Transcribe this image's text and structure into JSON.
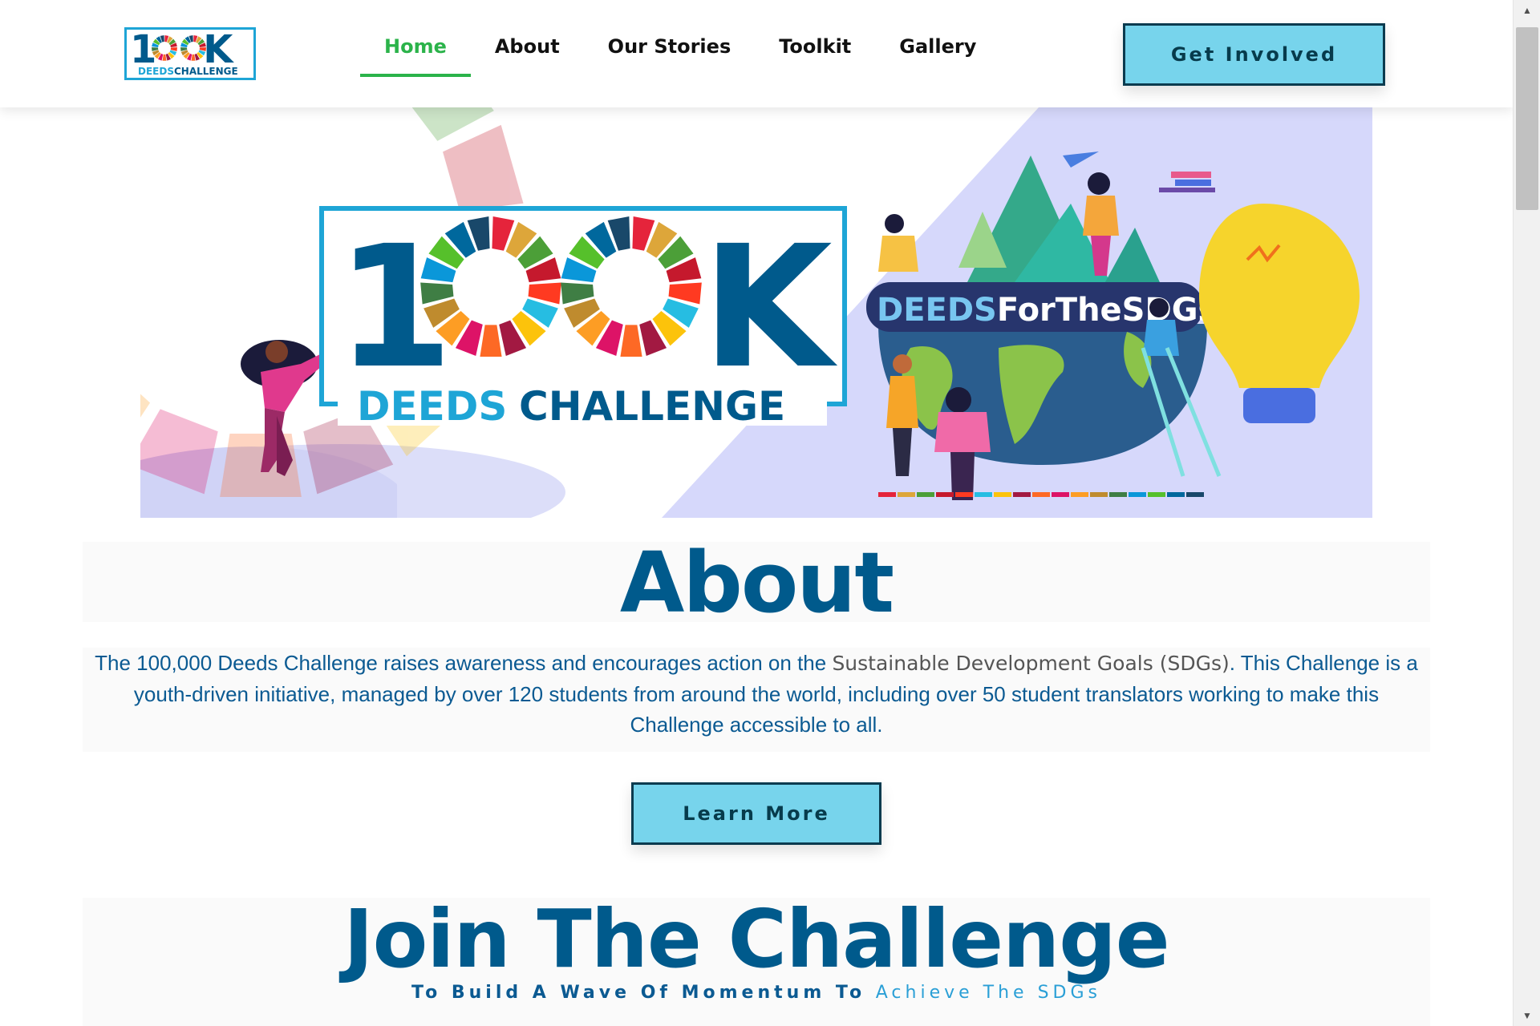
{
  "header": {
    "logo": {
      "top": "100K",
      "bottom_left": "DEEDS",
      "bottom_right": "CHALLENGE"
    },
    "nav": [
      {
        "label": "Home",
        "active": true
      },
      {
        "label": "About",
        "active": false
      },
      {
        "label": "Our Stories",
        "active": false
      },
      {
        "label": "Toolkit",
        "active": false
      },
      {
        "label": "Gallery",
        "active": false
      }
    ],
    "cta_label": "Get Involved"
  },
  "hero": {
    "title_big": "100K",
    "title_left": "DEEDS",
    "title_right": "CHALLENGE",
    "banner_text": "DEEDSForTheSDGs"
  },
  "about": {
    "title": "About",
    "text_before": "The 100,000 Deeds Challenge raises awareness and encourages action on the ",
    "text_link": "Sustainable Development Goals (SDGs)",
    "text_after": ".  This Challenge is a youth-driven initiative, managed by over 120 students from around the world, including over 50 student translators working to make this Challenge accessible to all.",
    "button_label": "Learn More"
  },
  "join": {
    "title": "Join The Challenge",
    "subtitle_before": "To Build A Wave Of Momentum To ",
    "subtitle_highlight": "Achieve The SDGs"
  },
  "colors": {
    "brand_blue": "#005a8c",
    "accent_green": "#2bb34a",
    "button_bg": "#77d4ec",
    "button_border": "#0b3b4f",
    "link_blue": "#2a9fd6"
  },
  "icons": [
    "scroll-up-arrow-icon",
    "scroll-down-arrow-icon"
  ]
}
